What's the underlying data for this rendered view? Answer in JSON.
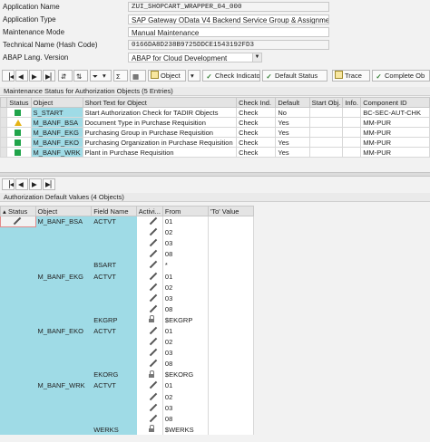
{
  "header": {
    "fields": [
      {
        "label": "Application Name",
        "value": "ZUI_SHOPCART_WRAPPER_04_000"
      },
      {
        "label": "Application Type",
        "value": "SAP Gateway OData V4 Backend Service Group & Assignme..."
      },
      {
        "label": "Maintenance Mode",
        "value": "Manual Maintenance"
      },
      {
        "label": "Technical Name (Hash Code)",
        "value": "0166DA8D238B9725DDCE1543192FD3"
      },
      {
        "label": "ABAP Lang. Version",
        "value": "ABAP for Cloud Development"
      }
    ]
  },
  "toolbar": {
    "object_label": "Object",
    "check_indicator_label": "Check Indicator",
    "default_status_label": "Default Status",
    "trace_label": "Trace",
    "complete_label": "Complete Ob"
  },
  "section1": {
    "title": "Maintenance Status for Authorization Objects (5 Entries)",
    "columns": [
      "Status",
      "Object",
      "Short Text for Object",
      "Check Ind.",
      "Default",
      "Start Obj.",
      "Info.",
      "Component ID"
    ],
    "rows": [
      {
        "status": "green",
        "object": "S_START",
        "text": "Start Authorization Check for TADIR Objects",
        "check": "Check",
        "default": "No",
        "start": "",
        "info": "",
        "component": "BC-SEC-AUT-CHK"
      },
      {
        "status": "yellow",
        "object": "M_BANF_BSA",
        "text": "Document Type in Purchase Requisition",
        "check": "Check",
        "default": "Yes",
        "start": "",
        "info": "",
        "component": "MM-PUR"
      },
      {
        "status": "green",
        "object": "M_BANF_EKG",
        "text": "Purchasing Group in Purchase Requisition",
        "check": "Check",
        "default": "Yes",
        "start": "",
        "info": "",
        "component": "MM-PUR"
      },
      {
        "status": "green",
        "object": "M_BANF_EKO",
        "text": "Purchasing Organization in Purchase Requisition",
        "check": "Check",
        "default": "Yes",
        "start": "",
        "info": "",
        "component": "MM-PUR"
      },
      {
        "status": "green",
        "object": "M_BANF_WRK",
        "text": "Plant in Purchase Requisition",
        "check": "Check",
        "default": "Yes",
        "start": "",
        "info": "",
        "component": "MM-PUR"
      }
    ]
  },
  "section2": {
    "title": "Authorization Default Values (4 Objects)",
    "columns": [
      "Status",
      "Object",
      "Field Name",
      "Activi...",
      "From",
      "'To' Value"
    ],
    "rows": [
      {
        "object": "M_BANF_BSA",
        "field": "ACTVT",
        "icon": "pencil",
        "from": "01"
      },
      {
        "object": "",
        "field": "",
        "icon": "pencil",
        "from": "02"
      },
      {
        "object": "",
        "field": "",
        "icon": "pencil",
        "from": "03"
      },
      {
        "object": "",
        "field": "",
        "icon": "pencil",
        "from": "08"
      },
      {
        "object": "",
        "field": "BSART",
        "icon": "pencil",
        "from": "*"
      },
      {
        "object": "M_BANF_EKG",
        "field": "ACTVT",
        "icon": "pencil",
        "from": "01"
      },
      {
        "object": "",
        "field": "",
        "icon": "pencil",
        "from": "02"
      },
      {
        "object": "",
        "field": "",
        "icon": "pencil",
        "from": "03"
      },
      {
        "object": "",
        "field": "",
        "icon": "pencil",
        "from": "08"
      },
      {
        "object": "",
        "field": "EKGRP",
        "icon": "lock",
        "from": "$EKGRP"
      },
      {
        "object": "M_BANF_EKO",
        "field": "ACTVT",
        "icon": "pencil",
        "from": "01"
      },
      {
        "object": "",
        "field": "",
        "icon": "pencil",
        "from": "02"
      },
      {
        "object": "",
        "field": "",
        "icon": "pencil",
        "from": "03"
      },
      {
        "object": "",
        "field": "",
        "icon": "pencil",
        "from": "08"
      },
      {
        "object": "",
        "field": "EKORG",
        "icon": "lock",
        "from": "$EKORG"
      },
      {
        "object": "M_BANF_WRK",
        "field": "ACTVT",
        "icon": "pencil",
        "from": "01"
      },
      {
        "object": "",
        "field": "",
        "icon": "pencil",
        "from": "02"
      },
      {
        "object": "",
        "field": "",
        "icon": "pencil",
        "from": "03"
      },
      {
        "object": "",
        "field": "",
        "icon": "pencil",
        "from": "08"
      },
      {
        "object": "",
        "field": "WERKS",
        "icon": "lock",
        "from": "$WERKS"
      }
    ]
  }
}
